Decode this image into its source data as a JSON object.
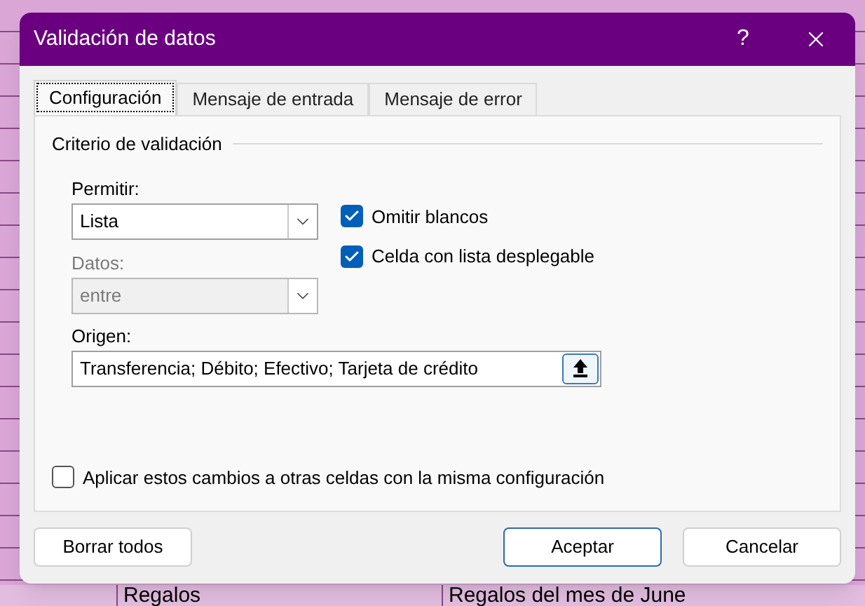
{
  "background_sheet": {
    "bottom_row": [
      "Regalos",
      "Regalos del mes de June"
    ]
  },
  "window": {
    "title": "Validación de datos",
    "help": "?"
  },
  "tabs": [
    {
      "label": "Configuración",
      "selected": true
    },
    {
      "label": "Mensaje de entrada",
      "selected": false
    },
    {
      "label": "Mensaje de error",
      "selected": false
    }
  ],
  "group_title": "Criterio de validación",
  "allow": {
    "label": "Permitir:",
    "value": "Lista",
    "disabled": false
  },
  "data": {
    "label": "Datos:",
    "value": "entre",
    "disabled": true
  },
  "checkboxes": [
    {
      "label": "Omitir blancos",
      "checked": true
    },
    {
      "label": "Celda con lista desplegable",
      "checked": true
    }
  ],
  "source": {
    "label": "Origen:",
    "value": "Transferencia; Débito; Efectivo; Tarjeta de crédito"
  },
  "apply_all": {
    "label": "Aplicar estos cambios a otras celdas con la misma configuración",
    "checked": false
  },
  "buttons": [
    {
      "label": "Borrar todos",
      "kind": "secondary"
    },
    {
      "label": "Aceptar",
      "kind": "default"
    },
    {
      "label": "Cancelar",
      "kind": "secondary"
    }
  ]
}
